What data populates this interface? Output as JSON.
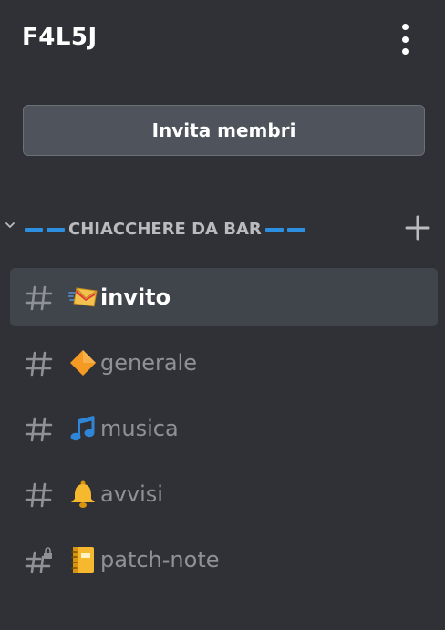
{
  "server": {
    "name": "F4L5J",
    "menu_icon": "kebab-menu-icon"
  },
  "invite": {
    "label": "Invita membri"
  },
  "category": {
    "name": "CHIACCHERE DA BAR",
    "collapse_icon": "chevron-down-icon",
    "add_icon": "plus-icon",
    "accent_color": "#2d8fe0"
  },
  "channels": [
    {
      "name": "invito",
      "emoji": "incoming-envelope-icon",
      "selected": true,
      "locked": false
    },
    {
      "name": "generale",
      "emoji": "orange-diamond-icon",
      "selected": false,
      "locked": false
    },
    {
      "name": "musica",
      "emoji": "musical-note-icon",
      "selected": false,
      "locked": false
    },
    {
      "name": "avvisi",
      "emoji": "bell-icon",
      "selected": false,
      "locked": false
    },
    {
      "name": "patch-note",
      "emoji": "notebook-icon",
      "selected": false,
      "locked": true
    }
  ],
  "colors": {
    "background": "#2f3136",
    "selected_row": "#40444b",
    "button": "#4f545c",
    "muted_text": "#8e9297"
  }
}
